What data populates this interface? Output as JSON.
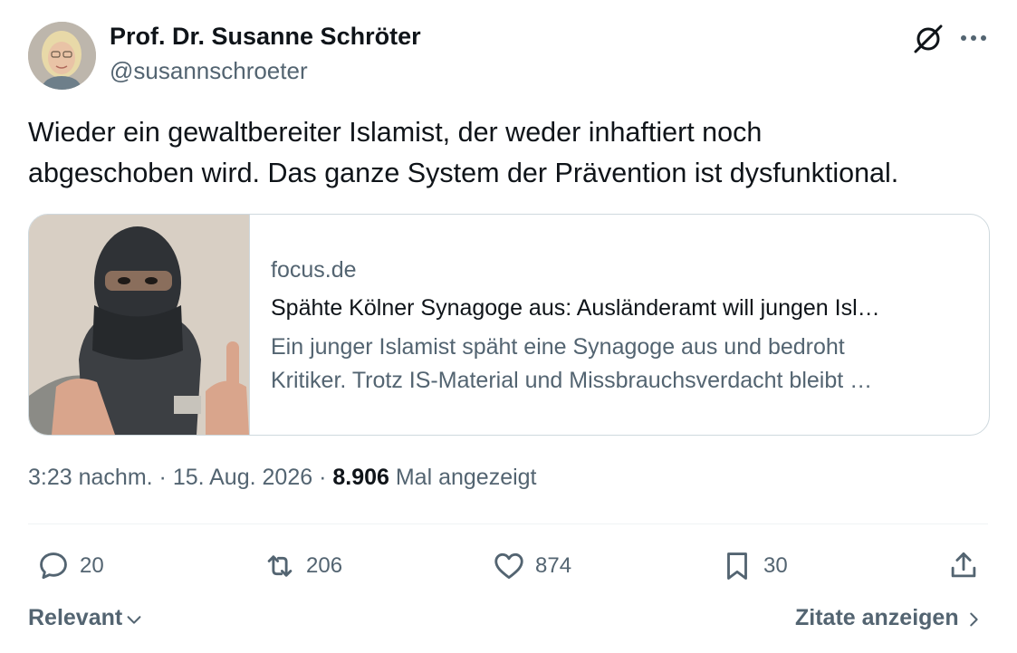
{
  "author": {
    "name": "Prof. Dr. Susanne Schröter",
    "handle": "@susannschroeter"
  },
  "tweet": {
    "line1": "Wieder ein gewaltbereiter Islamist, der weder inhaftiert noch",
    "line2": "abgeschoben wird. Das ganze System der Prävention ist dysfunktional."
  },
  "card": {
    "domain": "focus.de",
    "title": "Spähte Kölner Synagoge aus: Ausländeramt will jungen Isl…",
    "desc_line1": "Ein junger Islamist späht eine Synagoge aus und bedroht",
    "desc_line2": "Kritiker. Trotz IS-Material und Missbrauchsverdacht bleibt …"
  },
  "meta": {
    "time": "3:23 nachm.",
    "sep": " · ",
    "date": "15. Aug. 2026",
    "views_count": "8.906",
    "views_label": " Mal angezeigt"
  },
  "actions": {
    "replies": "20",
    "reposts": "206",
    "likes": "874",
    "bookmarks": "30"
  },
  "footer": {
    "sort_label": "Relevant",
    "quotes_label": "Zitate anzeigen"
  },
  "icons": {
    "grok": "grok-icon",
    "more": "more-icon",
    "reply": "reply-icon",
    "repost": "repost-icon",
    "like": "heart-icon",
    "bookmark": "bookmark-icon",
    "share": "share-icon"
  },
  "colors": {
    "text": "#0f1419",
    "secondary": "#536471",
    "border": "#cfd9de"
  }
}
